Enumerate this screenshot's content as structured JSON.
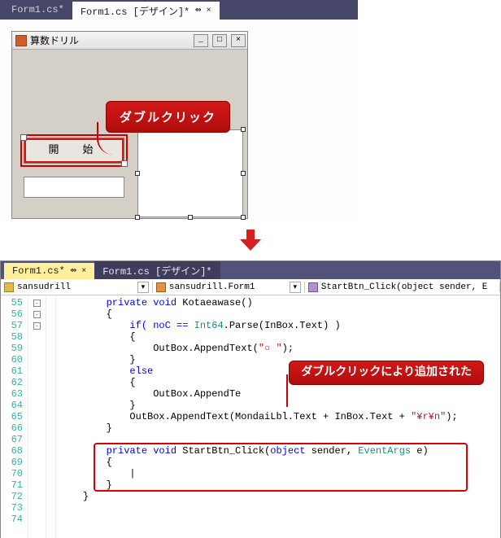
{
  "top": {
    "tabs": [
      {
        "label": "Form1.cs*"
      },
      {
        "label": "Form1.cs [デザイン]*"
      }
    ],
    "pin_glyph": "⇴",
    "close_glyph": "×",
    "form_title": "算数ドリル",
    "minimize": "_",
    "maximize": "□",
    "close": "×",
    "start_btn_label": "開　始",
    "callout": "ダブルクリック"
  },
  "bottom": {
    "tabs": [
      {
        "label": "Form1.cs*"
      },
      {
        "label": "Form1.cs [デザイン]*"
      }
    ],
    "pin_glyph": "⇴",
    "close_glyph": "×",
    "nav": {
      "namespace": "sansudrill",
      "class": "sansudrill.Form1",
      "method": "StartBtn_Click(object sender, E"
    },
    "callout": "ダブルクリックにより追加された",
    "line_numbers": [
      "55",
      "56",
      "57",
      "58",
      "59",
      "60",
      "61",
      "62",
      "63",
      "64",
      "65",
      "66",
      "67",
      "68",
      "69",
      "70",
      "71",
      "72",
      "73",
      "74"
    ],
    "code": {
      "l55": "private void Kotaeawase()",
      "l56_open": "{",
      "l57_if": "if( noC == ",
      "l57_type": "Int64",
      "l57_after": ".Parse(InBox.Text) )",
      "l58_open": "{",
      "l59_pre": "OutBox.AppendText(",
      "l59_str": "\"○ \"",
      "l59_post": ");",
      "l60_close": "}",
      "l61_else": "else",
      "l62_open": "{",
      "l63": "OutBox.AppendTe",
      "l64_close": "}",
      "l65_pre": "OutBox.AppendText(MondaiLbl.Text + InBox.Text + ",
      "l65_str": "\"¥r¥n\"",
      "l65_post": ");",
      "l66_close": "}",
      "l67": "",
      "l68_priv": "private",
      "l68_void": " void",
      "l68_name": " StartBtn_Click(",
      "l68_obj": "object",
      "l68_sender": " sender, ",
      "l68_ev": "EventArgs",
      "l68_e": " e)",
      "l69_open": "{",
      "l70_caret": "|",
      "l71_close": "}",
      "l72_close": "}",
      "l73": "",
      "l74": ""
    }
  }
}
